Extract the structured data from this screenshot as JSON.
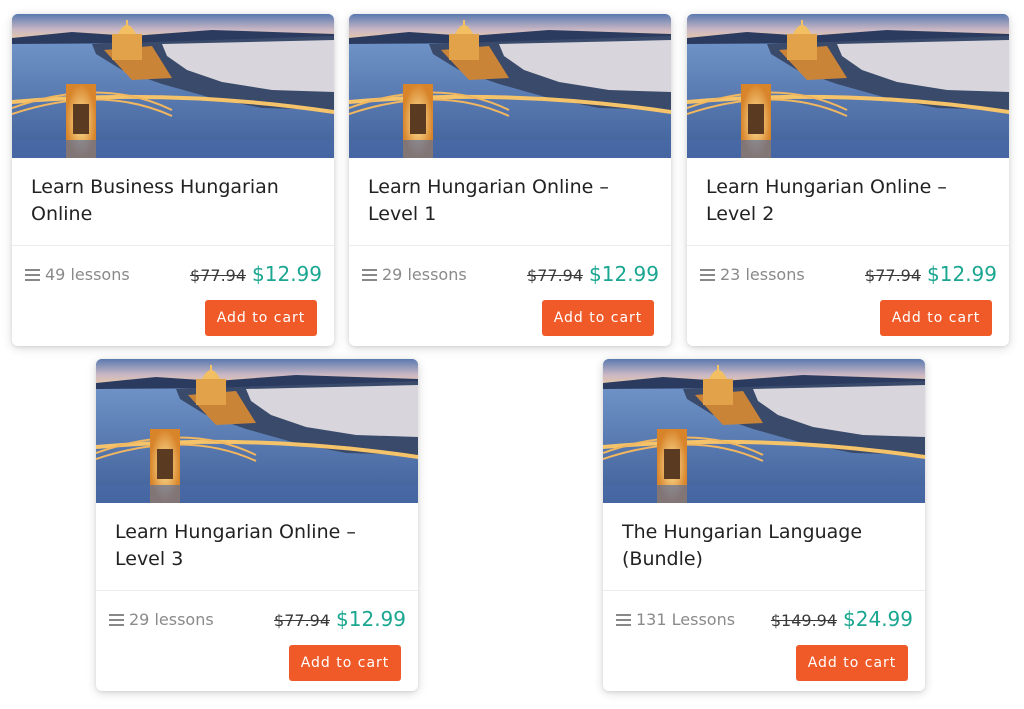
{
  "colors": {
    "accent": "#f05a28",
    "sale_price": "#1aa690"
  },
  "cards": [
    {
      "title": "Learn Business Hungarian Online",
      "lessons": "49 lessons",
      "old_price": "$77.94",
      "price": "$12.99",
      "button": "Add to cart"
    },
    {
      "title": "Learn Hungarian Online – Level 1",
      "lessons": "29 lessons",
      "old_price": "$77.94",
      "price": "$12.99",
      "button": "Add to cart"
    },
    {
      "title": "Learn Hungarian Online – Level 2",
      "lessons": "23 lessons",
      "old_price": "$77.94",
      "price": "$12.99",
      "button": "Add to cart"
    },
    {
      "title": "Learn Hungarian Online – Level 3",
      "lessons": "29 lessons",
      "old_price": "$77.94",
      "price": "$12.99",
      "button": "Add to cart"
    },
    {
      "title": "The Hungarian Language (Bundle)",
      "lessons": "131 Lessons",
      "old_price": "$149.94",
      "price": "$24.99",
      "button": "Add to cart"
    }
  ]
}
